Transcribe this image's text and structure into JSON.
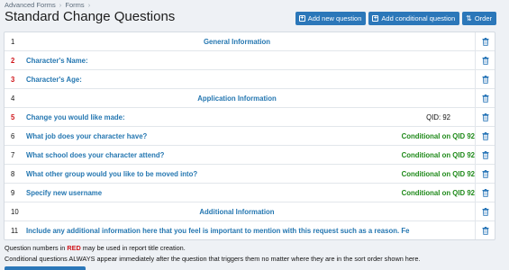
{
  "breadcrumb": {
    "items": [
      "Advanced Forms",
      "Forms"
    ],
    "separator": "›"
  },
  "page_title": "Standard Change Questions",
  "toolbar": {
    "add_question_label": "Add new question",
    "add_conditional_label": "Add conditional question",
    "order_label": "Order",
    "add_icon": "plus-square-icon",
    "order_icon": "sort-icon"
  },
  "questions": [
    {
      "num": "1",
      "num_red": false,
      "text": "General Information",
      "centered": true,
      "meta": "",
      "meta_type": ""
    },
    {
      "num": "2",
      "num_red": true,
      "text": "Character's Name:",
      "centered": false,
      "meta": "",
      "meta_type": ""
    },
    {
      "num": "3",
      "num_red": true,
      "text": "Character's Age:",
      "centered": false,
      "meta": "",
      "meta_type": ""
    },
    {
      "num": "4",
      "num_red": false,
      "text": "Application Information",
      "centered": true,
      "meta": "",
      "meta_type": ""
    },
    {
      "num": "5",
      "num_red": true,
      "text": "Change you would like made:",
      "centered": false,
      "meta": "QID: 92",
      "meta_type": "qid"
    },
    {
      "num": "6",
      "num_red": false,
      "text": "What job does your character have?",
      "centered": false,
      "meta": "Conditional on QID 92",
      "meta_type": "cond"
    },
    {
      "num": "7",
      "num_red": false,
      "text": "What school does your character attend?",
      "centered": false,
      "meta": "Conditional on QID 92",
      "meta_type": "cond"
    },
    {
      "num": "8",
      "num_red": false,
      "text": "What other group would you like to be moved into?",
      "centered": false,
      "meta": "Conditional on QID 92",
      "meta_type": "cond"
    },
    {
      "num": "9",
      "num_red": false,
      "text": "Specify new username",
      "centered": false,
      "meta": "Conditional on QID 92",
      "meta_type": "cond"
    },
    {
      "num": "10",
      "num_red": false,
      "text": "Additional Information",
      "centered": true,
      "meta": "",
      "meta_type": ""
    },
    {
      "num": "11",
      "num_red": false,
      "text": "Include any additional information here that you feel is important to mention with this request such as a reason. Fe",
      "centered": false,
      "meta": "",
      "meta_type": ""
    }
  ],
  "delete_icon": "trash-icon",
  "notes": {
    "line1_before": "Question numbers in ",
    "line1_red": "RED",
    "line1_after": " may be used in report title creation.",
    "line2": "Conditional questions ALWAYS appear immediately after the question that triggers them no matter where they are in the sort order shown here."
  },
  "colors": {
    "accent": "#2b77b9",
    "link": "#2577b1",
    "red": "#d0161b",
    "green": "#1f8a1a"
  }
}
